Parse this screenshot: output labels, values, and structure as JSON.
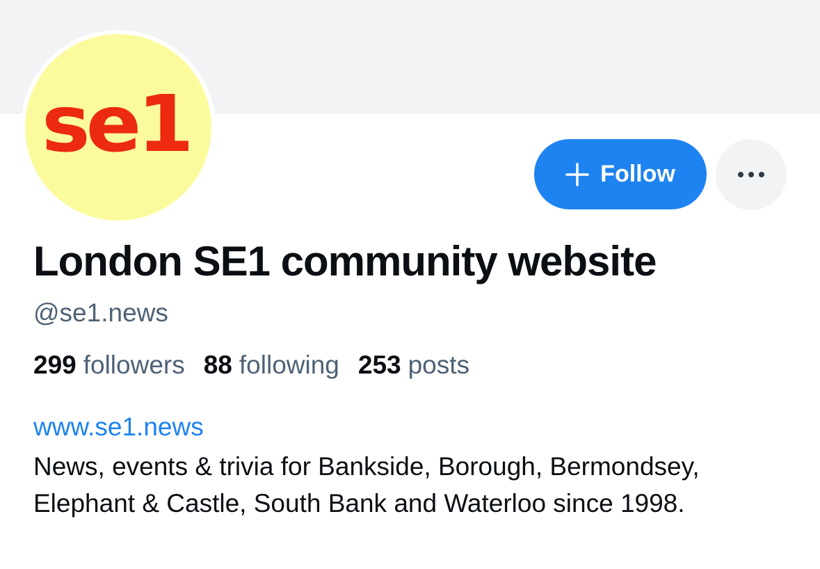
{
  "profile": {
    "avatar_text": "se1",
    "display_name": "London SE1 community website",
    "handle": "@se1.news",
    "website": "www.se1.news",
    "bio": "News, events & trivia for Bankside, Borough, Bermondsey, Elephant & Castle, South Bank and Waterloo since 1998."
  },
  "actions": {
    "follow_label": "Follow",
    "follow_icon": "plus-icon",
    "more_icon": "more-horizontal-icon"
  },
  "stats": {
    "followers_count": "299",
    "followers_label": "followers",
    "following_count": "88",
    "following_label": "following",
    "posts_count": "253",
    "posts_label": "posts"
  },
  "colors": {
    "accent": "#1d83f0",
    "muted_text": "#4e6175",
    "avatar_background": "#fbfb9e",
    "avatar_logo": "#ec2a0f",
    "banner": "#f1f3f5"
  }
}
